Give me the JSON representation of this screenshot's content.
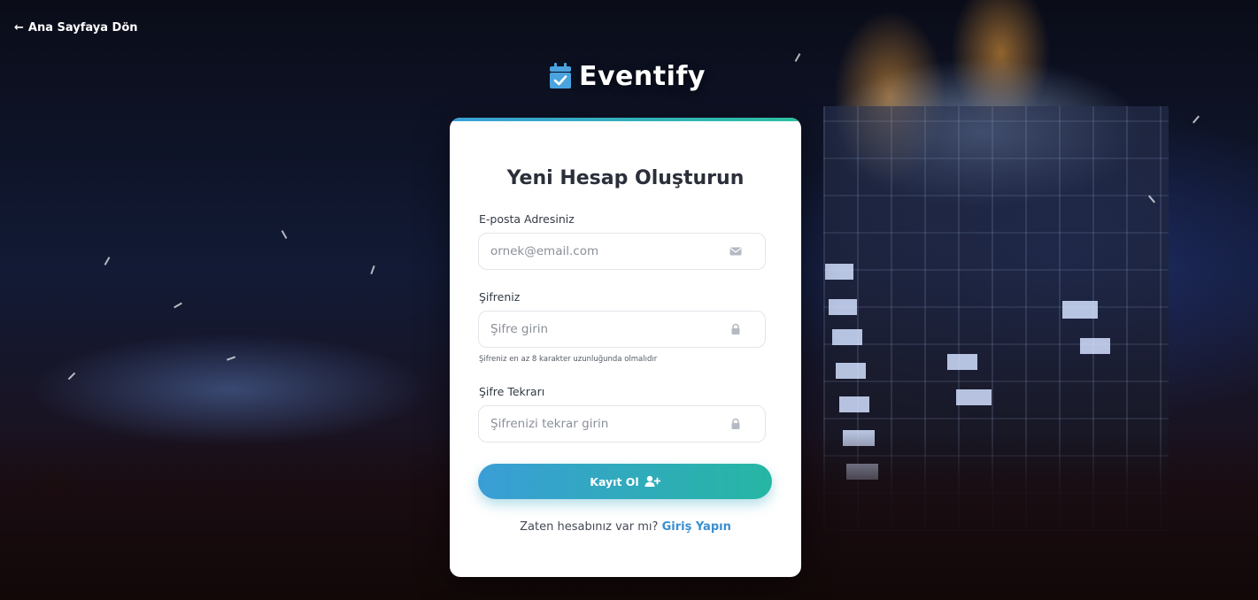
{
  "nav": {
    "back_label": "Ana Sayfaya Dön"
  },
  "brand": {
    "name": "Eventify",
    "icon": "calendar-check-icon",
    "accent": "#4aa3df"
  },
  "form": {
    "title": "Yeni Hesap Oluşturun",
    "email": {
      "label": "E-posta Adresiniz",
      "placeholder": "ornek@email.com",
      "value": "",
      "icon": "envelope-icon"
    },
    "password": {
      "label": "Şifreniz",
      "placeholder": "Şifre girin",
      "value": "",
      "icon": "lock-icon",
      "hint": "Şifreniz en az 8 karakter uzunluğunda olmalıdır"
    },
    "password_confirm": {
      "label": "Şifre Tekrarı",
      "placeholder": "Şifrenizi tekrar girin",
      "value": "",
      "icon": "lock-icon"
    },
    "submit_label": "Kayıt Ol",
    "submit_icon": "user-plus-icon",
    "footer_prompt": "Zaten hesabınız var mı?",
    "footer_link": "Giriş Yapın"
  },
  "colors": {
    "button_gradient_start": "#3a9ed6",
    "button_gradient_end": "#26b6a3",
    "link": "#3a8fd0",
    "title": "#2b2f3a"
  }
}
